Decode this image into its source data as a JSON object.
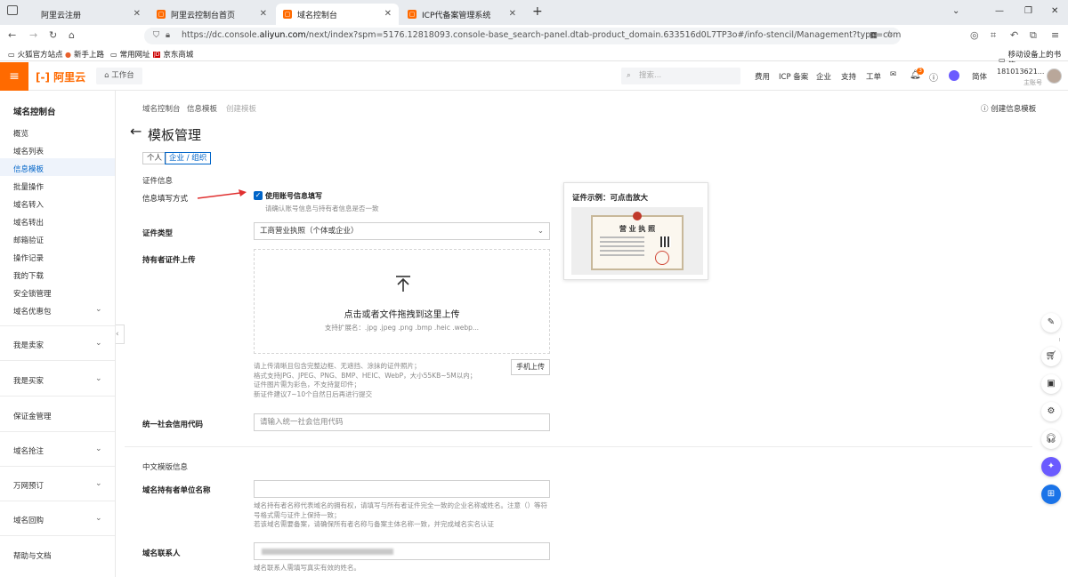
{
  "browser": {
    "tabs": [
      {
        "label": "阿里云注册",
        "active": false
      },
      {
        "label": "阿里云控制台首页",
        "active": false
      },
      {
        "label": "域名控制台",
        "active": true
      },
      {
        "label": "ICP代备案管理系统",
        "active": false
      }
    ],
    "new_tab": "+",
    "url_prefix": "https://dc.console.",
    "url_domain": "aliyun.com",
    "url_suffix": "/next/index?spm=5176.12818093.console-base_search-panel.dtab-product_domain.633516d0L7TP3o#/info-stencil/Management?type=common",
    "bookmarks": [
      "火狐官方站点",
      "新手上路",
      "常用网址",
      "京东商城"
    ],
    "mobile_bookmarks": "移动设备上的书签"
  },
  "header": {
    "logo": "阿里云",
    "workbench": "工作台",
    "search_placeholder": "搜索...",
    "links": [
      "费用",
      "ICP 备案",
      "企业",
      "支持",
      "工单"
    ],
    "lang": "简体",
    "account": "181013621...",
    "account_sub": "主账号",
    "notice_badge": "3",
    "brand_color": "#ff6a00"
  },
  "sidebar": {
    "title": "域名控制台",
    "items": [
      "概览",
      "域名列表",
      "信息模板",
      "批量操作",
      "域名转入",
      "域名转出",
      "邮箱验证",
      "操作记录",
      "我的下载",
      "安全锁管理",
      "域名优惠包"
    ],
    "active_item": "信息模板",
    "groups": [
      "我是卖家",
      "我是买家",
      "保证金管理",
      "域名抢注",
      "万网预订",
      "域名回购",
      "帮助与文档"
    ]
  },
  "main": {
    "breadcrumb": [
      "域名控制台",
      "信息模板",
      "创建模板"
    ],
    "create_link": "创建信息模板",
    "title": "模板管理",
    "seg_personal": "个人",
    "seg_company": "企业 / 组织",
    "section_cert": "证件信息",
    "fill_label": "信息填写方式",
    "checkbox_label": "使用账号信息填写",
    "checkbox_checked": true,
    "checkbox_hint": "请确认账号信息与持有者信息是否一致",
    "cert_type_label": "证件类型",
    "cert_type_value": "工商营业执照（个体或企业）",
    "upload_label": "持有者证件上传",
    "upload_title": "点击或者文件拖拽到这里上传",
    "upload_ext": "支持扩展名：.jpg .jpeg .png .bmp .heic .webp...",
    "upload_hints": [
      "请上传清晰且包含完整边框、无遮挡、涂抹的证件照片；",
      "格式支持JPG、JPEG、PNG、BMP、HEIC、WebP，大小55KB~5M以内；",
      "证件图片需为彩色，不支持复印件；",
      "新证件建议7~10个自然日后再进行提交"
    ],
    "mobile_upload": "手机上传",
    "credit_label": "统一社会信用代码",
    "credit_placeholder": "请输入统一社会信用代码",
    "section_cn": "中文模版信息",
    "owner_label": "域名持有者单位名称",
    "owner_hints": [
      "域名持有者名称代表域名的拥有权，请填写与所有者证件完全一致的企业名称或姓名。注意（）等符",
      "号格式需与证件上保持一致；",
      "若该域名需要备案，请确保所有者名称与备案主体名称一致，并完成域名实名认证"
    ],
    "contact_label": "域名联系人",
    "contact_hint": "域名联系人需填写真实有效的姓名。",
    "popover_title": "证件示例：可点击放大",
    "license_text": "营 业 执 照"
  }
}
